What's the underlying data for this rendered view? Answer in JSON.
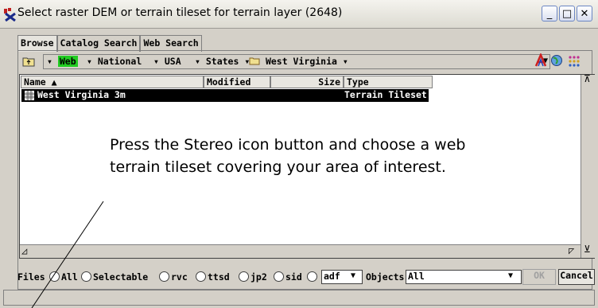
{
  "window": {
    "title": "Select raster DEM or terrain tileset for terrain layer (2648)",
    "controls": {
      "minimize": "_",
      "maximize": "□",
      "close": "✕"
    }
  },
  "tabs": [
    {
      "label": "Browse",
      "active": true
    },
    {
      "label": "Catalog Search",
      "active": false
    },
    {
      "label": "Web Search",
      "active": false
    }
  ],
  "path": {
    "crumbs": [
      "Web",
      "National",
      "USA",
      "States",
      "West Virginia"
    ],
    "highlight_color": "#22cc22"
  },
  "list": {
    "columns": [
      "Name ▲",
      "Modified",
      "Size",
      "Type"
    ],
    "rows": [
      {
        "name": "West Virginia 3m",
        "modified": "",
        "size": "",
        "type": "Terrain Tileset",
        "selected": true
      }
    ]
  },
  "callout": {
    "text": "Press the Stereo icon button and choose a web terrain tileset covering your area of interest."
  },
  "filters": {
    "label": "Files",
    "options": [
      "All",
      "Selectable",
      "rvc",
      "ttsd",
      "jp2",
      "sid"
    ],
    "format_value": "adf",
    "objects_label": "Objects",
    "objects_value": "All",
    "ok_label": "OK",
    "cancel_label": "Cancel"
  }
}
